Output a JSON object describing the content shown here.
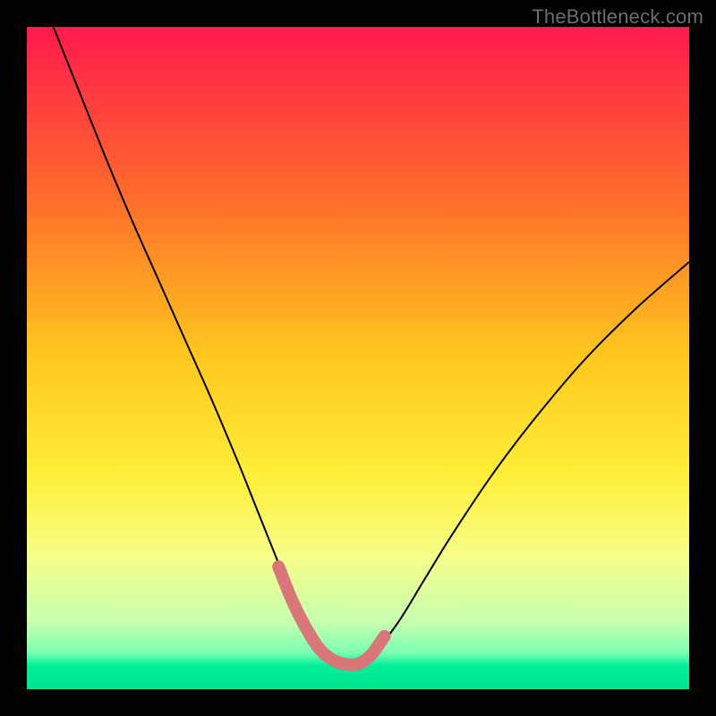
{
  "watermark": "TheBottleneck.com",
  "chart_data": {
    "type": "line",
    "title": "",
    "xlabel": "",
    "ylabel": "",
    "xlim": [
      0,
      100
    ],
    "ylim": [
      0,
      100
    ],
    "background_gradient": {
      "stops": [
        {
          "offset": 0.0,
          "color": "#ff1a4d"
        },
        {
          "offset": 0.25,
          "color": "#ff6a2c"
        },
        {
          "offset": 0.5,
          "color": "#ffc81e"
        },
        {
          "offset": 0.68,
          "color": "#ffef3a"
        },
        {
          "offset": 0.8,
          "color": "#f7ff8a"
        },
        {
          "offset": 0.9,
          "color": "#c6ffb0"
        },
        {
          "offset": 0.945,
          "color": "#7affb0"
        },
        {
          "offset": 0.965,
          "color": "#00ef9a"
        },
        {
          "offset": 1.0,
          "color": "#00e58f"
        }
      ]
    },
    "series": [
      {
        "name": "bottleneck-curve",
        "stroke": "#000000",
        "stroke_width": 2,
        "x": [
          4,
          8,
          12,
          16,
          20,
          24,
          28,
          32,
          34,
          36,
          38,
          40,
          42,
          44,
          46,
          48,
          50,
          52,
          56,
          60,
          64,
          70,
          76,
          84,
          92,
          100
        ],
        "y": [
          100,
          90,
          80,
          70.5,
          61.5,
          52.5,
          43.5,
          34,
          29,
          24,
          19,
          14,
          10,
          6.5,
          4.5,
          3.8,
          3.8,
          5,
          10,
          16.5,
          23,
          32,
          40,
          49.5,
          57.5,
          64.5
        ]
      }
    ],
    "highlight": {
      "name": "valley-overlay",
      "stroke": "#d9767a",
      "stroke_width": 14,
      "x": [
        38,
        40,
        42,
        44,
        46,
        48,
        50,
        52,
        54
      ],
      "y": [
        18.5,
        13.5,
        9.5,
        6.3,
        4.5,
        3.8,
        3.8,
        5.2,
        8
      ]
    }
  }
}
